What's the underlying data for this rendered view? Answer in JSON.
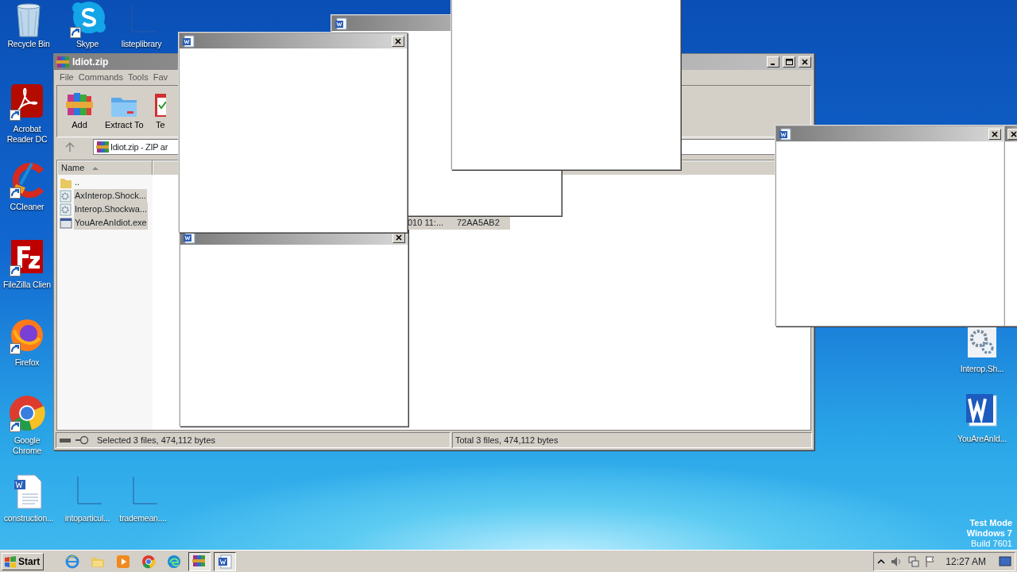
{
  "desktop_icons": [
    {
      "label": "Recycle Bin",
      "kind": "recycle",
      "shortcut": false
    },
    {
      "label": "Skype",
      "kind": "skype",
      "shortcut": true
    },
    {
      "label": "listeplibrary",
      "kind": "blank",
      "shortcut": false
    },
    {
      "label": "Acrobat Reader DC",
      "kind": "acrobat",
      "shortcut": true
    },
    {
      "label": "CCleaner",
      "kind": "ccleaner",
      "shortcut": true
    },
    {
      "label": "FileZilla Clien",
      "kind": "filezilla",
      "shortcut": true
    },
    {
      "label": "Firefox",
      "kind": "firefox",
      "shortcut": true
    },
    {
      "label": "Google Chrome",
      "kind": "chrome",
      "shortcut": true
    },
    {
      "label": "construction...",
      "kind": "worddoc",
      "shortcut": false
    },
    {
      "label": "intoparticul...",
      "kind": "blank",
      "shortcut": false
    },
    {
      "label": "trademean....",
      "kind": "blank",
      "shortcut": false
    },
    {
      "label": "Interop.Sh...",
      "kind": "gears",
      "shortcut": false
    },
    {
      "label": "YouAreAnId...",
      "kind": "word",
      "shortcut": false
    }
  ],
  "archive_window": {
    "title": "Idiot.zip",
    "menu": [
      "File",
      "Commands",
      "Tools",
      "Fav"
    ],
    "toolbar": [
      {
        "label": "Add",
        "kind": "add"
      },
      {
        "label": "Extract To",
        "kind": "extract"
      },
      {
        "label": "Te",
        "kind": "test"
      }
    ],
    "address": "Idiot.zip - ZIP ar",
    "columns": [
      {
        "label": "Name",
        "sorted": true
      }
    ],
    "rows": [
      {
        "name": "..",
        "kind": "folder",
        "selected": false
      },
      {
        "name": "AxInterop.Shock...",
        "kind": "dll",
        "selected": true
      },
      {
        "name": "Interop.Shockwa...",
        "kind": "dll",
        "selected": true
      },
      {
        "name": "YouAreAnIdiot.exe",
        "kind": "exe",
        "selected": true,
        "modified": "010 11:...",
        "crc": "72AA5AB2"
      }
    ],
    "status_left": "Selected 3 files, 474,112 bytes",
    "status_right": "Total 3 files, 474,112 bytes"
  },
  "popup_windows": [
    {
      "kind": "titled-no-close"
    },
    {
      "kind": "untitled"
    },
    {
      "kind": "titled"
    },
    {
      "kind": "titled"
    },
    {
      "kind": "titled"
    },
    {
      "kind": "titled"
    }
  ],
  "os_notice": [
    "Test Mode",
    "Windows 7",
    "Build 7601"
  ],
  "taskbar": {
    "start": "Start",
    "apps": [
      {
        "kind": "ie",
        "active": false
      },
      {
        "kind": "explorer",
        "active": false
      },
      {
        "kind": "media",
        "active": false
      },
      {
        "kind": "chrome",
        "active": false
      },
      {
        "kind": "edge",
        "active": false
      },
      {
        "kind": "winrar",
        "active": true
      },
      {
        "kind": "word",
        "active": true
      }
    ],
    "clock": "12:27 AM"
  }
}
